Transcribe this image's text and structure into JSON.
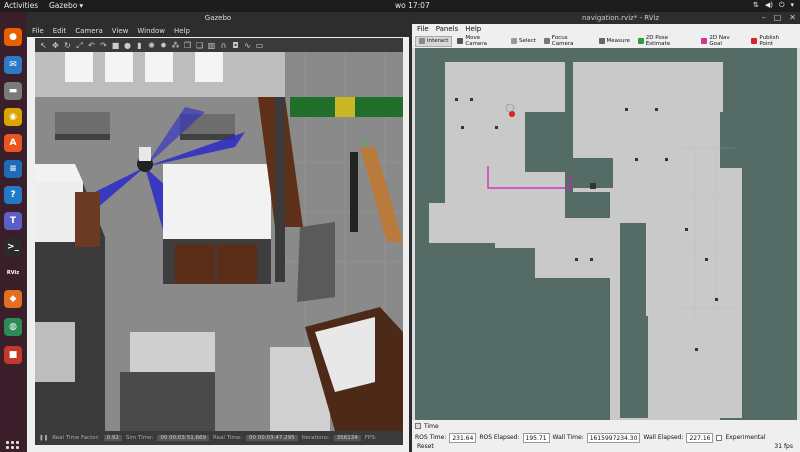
{
  "topbar": {
    "activities": "Activities",
    "app": "Gazebo",
    "clock": "wo 17:07"
  },
  "dock": {
    "icons": [
      {
        "name": "firefox-icon",
        "glyph": "●",
        "color": "#e66000"
      },
      {
        "name": "mail-icon",
        "glyph": "✉",
        "color": "#2a7bc4"
      },
      {
        "name": "files-icon",
        "glyph": "▬",
        "color": "#7a7a7a"
      },
      {
        "name": "music-icon",
        "glyph": "◉",
        "color": "#d8a400"
      },
      {
        "name": "software-icon",
        "glyph": "A",
        "color": "#e95420"
      },
      {
        "name": "writer-icon",
        "glyph": "≡",
        "color": "#1e6bb8"
      },
      {
        "name": "help-icon",
        "glyph": "?",
        "color": "#2478c8"
      },
      {
        "name": "teams-icon",
        "glyph": "T",
        "color": "#5b5fc7"
      },
      {
        "name": "terminal-icon",
        "glyph": ">_",
        "color": "#2b2b2b"
      },
      {
        "name": "rviz-icon",
        "glyph": "RViz",
        "color": "#3a1f2a"
      },
      {
        "name": "stack-icon",
        "glyph": "◆",
        "color": "#e07020"
      },
      {
        "name": "globe-icon",
        "glyph": "◍",
        "color": "#2e8b57"
      },
      {
        "name": "screenshot-icon",
        "glyph": "■",
        "color": "#c0392b"
      }
    ]
  },
  "gazebo": {
    "title": "Gazebo",
    "menu": [
      "File",
      "Edit",
      "Camera",
      "View",
      "Window",
      "Help"
    ],
    "status": {
      "rtf_label": "Real Time Factor:",
      "rtf_value": "0.92",
      "sim_label": "Sim Time:",
      "sim_value": "00 00:03:51.669",
      "real_label": "Real Time:",
      "real_value": "00 00:03:47.295",
      "iter_label": "Iterations:",
      "iter_value": "356134",
      "fps_label": "FPS:"
    }
  },
  "rviz": {
    "title": "navigation.rviz* - RViz",
    "menu": [
      "File",
      "Panels",
      "Help"
    ],
    "tools": [
      {
        "label": "Interact",
        "color": "#888",
        "active": true
      },
      {
        "label": "Move Camera",
        "color": "#555",
        "active": false
      },
      {
        "label": "Select",
        "color": "#999",
        "active": false
      },
      {
        "label": "Focus Camera",
        "color": "#777",
        "active": false
      },
      {
        "label": "Measure",
        "color": "#666",
        "active": false
      },
      {
        "label": "2D Pose Estimate",
        "color": "#2a9d3e",
        "active": false
      },
      {
        "label": "2D Nav Goal",
        "color": "#c43b8f",
        "active": false
      },
      {
        "label": "Publish Point",
        "color": "#d22",
        "active": false
      }
    ],
    "time_panel": {
      "header": "Time",
      "ros_time_label": "ROS Time:",
      "ros_time": "231.64",
      "ros_elapsed_label": "ROS Elapsed:",
      "ros_elapsed": "195.71",
      "wall_time_label": "Wall Time:",
      "wall_time": "1615997234.30",
      "wall_elapsed_label": "Wall Elapsed:",
      "wall_elapsed": "227.16",
      "experimental": "Experimental"
    },
    "reset": "Reset",
    "fps": "31 fps"
  }
}
